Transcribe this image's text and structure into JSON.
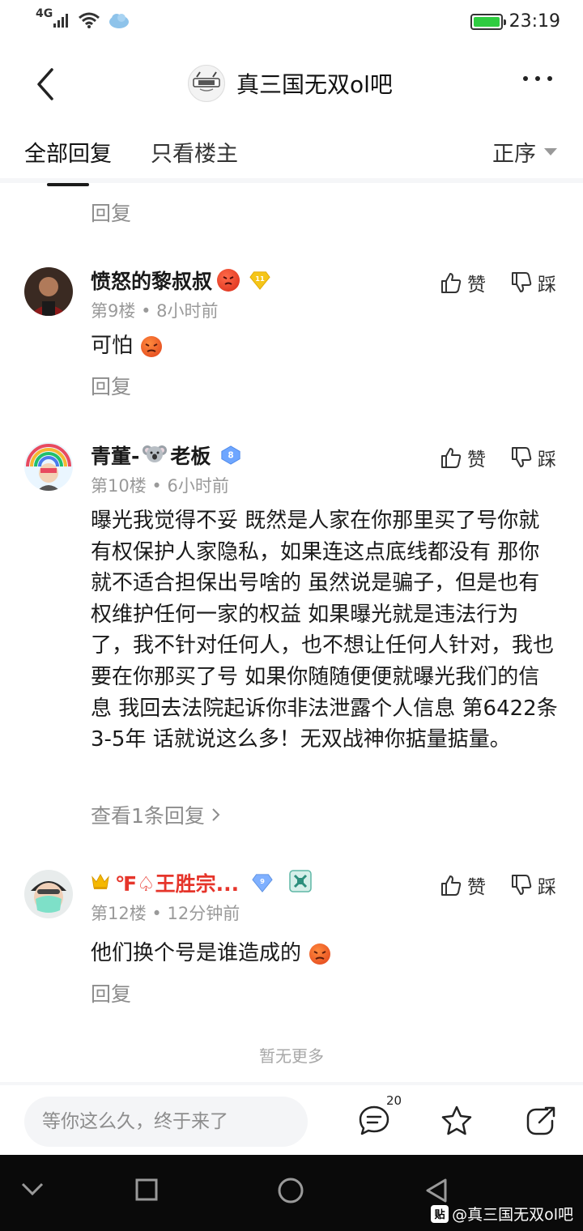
{
  "status_bar": {
    "network": "4G",
    "time": "23:19",
    "battery_level": 1.0
  },
  "header": {
    "title": "真三国无双ol吧"
  },
  "tabs": {
    "all_replies": "全部回复",
    "owner_only": "只看楼主",
    "sort_label": "正序"
  },
  "partial_post": {
    "reply_label": "回复"
  },
  "comments": [
    {
      "username": "愤怒的黎叔叔",
      "level": "11",
      "floor": "第9楼",
      "time": "8小时前",
      "text": "可怕",
      "reply_label": "回复",
      "like_label": "赞",
      "dislike_label": "踩"
    },
    {
      "username_pre": "青董-",
      "username_post": "老板",
      "level": "8",
      "floor": "第10楼",
      "time": "6小时前",
      "text": "曝光我觉得不妥 既然是人家在你那里买了号你就有权保护人家隐私，如果连这点底线都没有 那你就不适合担保出号啥的 虽然说是骗子，但是也有权维护任何一家的权益 如果曝光就是违法行为了，我不针对任何人，也不想让任何人针对，我也要在你那买了号 如果你随随便便就曝光我们的信息 我回去法院起诉你非法泄露个人信息 第6422条 3-5年 话就说这么多！无双战神你掂量掂量。",
      "view_replies": "查看1条回复",
      "like_label": "赞",
      "dislike_label": "踩"
    },
    {
      "username": "℉♤王胜宗...",
      "level": "9",
      "floor": "第12楼",
      "time": "12分钟前",
      "text": "他们换个号是谁造成的",
      "reply_label": "回复",
      "like_label": "赞",
      "dislike_label": "踩"
    }
  ],
  "footer": {
    "no_more": "暂无更多"
  },
  "input_bar": {
    "placeholder": "等你这么久，终于来了",
    "comment_count": "20"
  },
  "watermark": {
    "logo": "贴",
    "text": "@真三国无双ol吧"
  },
  "colors": {
    "accent_red": "#e6352b",
    "meta_gray": "#9a9a9a",
    "battery_green": "#2ecc40"
  }
}
